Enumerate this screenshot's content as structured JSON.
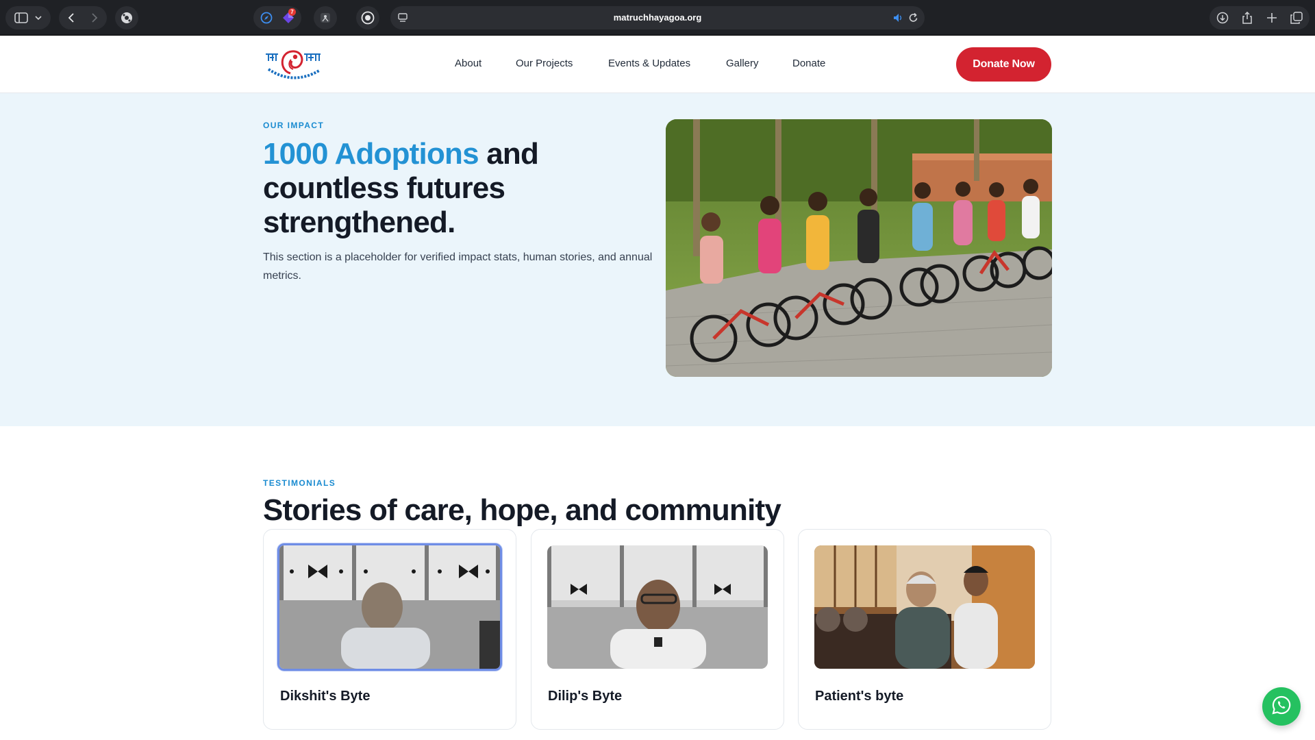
{
  "browser": {
    "url": "matruchhayagoa.org",
    "notification_count": "7",
    "icons": [
      "sidebar-icon",
      "chevron-down-icon",
      "back-icon",
      "forward-icon",
      "extension-icon",
      "compass-icon",
      "gem-icon",
      "privacy-icon",
      "record-icon",
      "page-menu-icon",
      "speaker-icon",
      "reload-icon",
      "download-icon",
      "share-icon",
      "plus-icon",
      "tabs-icon"
    ]
  },
  "header": {
    "logo_alt": "Matru Chhaya",
    "nav": [
      "About",
      "Our Projects",
      "Events & Updates",
      "Gallery",
      "Donate"
    ],
    "cta": "Donate Now"
  },
  "impact": {
    "eyebrow": "OUR IMPACT",
    "headline_highlight": "1000 Adoptions",
    "headline_rest": " and countless futures strengthened.",
    "description": "This section is a placeholder for verified impact stats, human stories, and annual metrics."
  },
  "testimonials": {
    "eyebrow": "TESTIMONIALS",
    "title": "Stories of care, hope, and community",
    "cards": [
      {
        "title": "Dikshit's Byte"
      },
      {
        "title": "Dilip's Byte"
      },
      {
        "title": "Patient's byte"
      }
    ]
  },
  "colors": {
    "accent_blue": "#2392d4",
    "donate_red": "#d32330",
    "impact_bg": "#ebf5fb",
    "whatsapp_green": "#25c160"
  }
}
